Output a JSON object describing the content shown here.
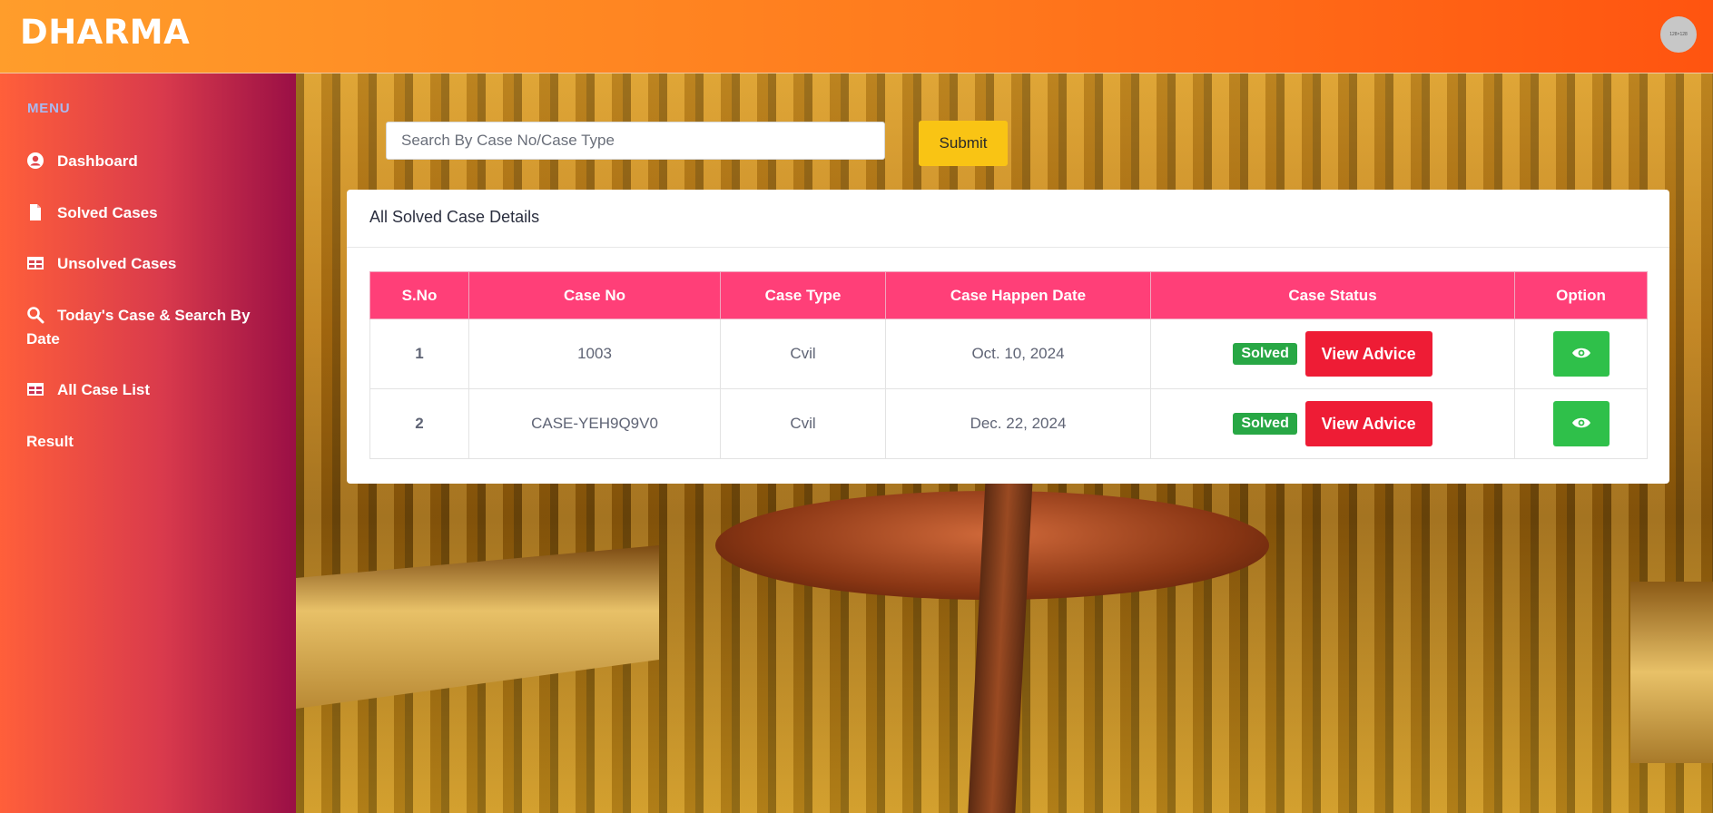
{
  "header": {
    "brand": "DHARMA",
    "avatar_text": "128×128"
  },
  "sidebar": {
    "menu_title": "MENU",
    "items": [
      {
        "label": "Dashboard",
        "icon": "user-circle-icon"
      },
      {
        "label": "Solved Cases",
        "icon": "document-icon"
      },
      {
        "label": "Unsolved Cases",
        "icon": "table-icon"
      },
      {
        "label": "Today's Case & Search By Date",
        "icon": "search-icon"
      },
      {
        "label": "All Case List",
        "icon": "table-icon"
      },
      {
        "label": "Result",
        "icon": ""
      }
    ]
  },
  "search": {
    "placeholder": "Search By Case No/Case Type",
    "value": "",
    "submit_label": "Submit"
  },
  "card": {
    "title": "All Solved Case Details",
    "columns": [
      "S.No",
      "Case No",
      "Case Type",
      "Case Happen Date",
      "Case Status",
      "Option"
    ],
    "rows": [
      {
        "sno": "1",
        "case_no": "1003",
        "case_type": "Cvil",
        "date": "Oct. 10, 2024",
        "status": "Solved",
        "action": "View Advice",
        "option_icon": "eye-icon"
      },
      {
        "sno": "2",
        "case_no": "CASE-YEH9Q9V0",
        "case_type": "Cvil",
        "date": "Dec. 22, 2024",
        "status": "Solved",
        "action": "View Advice",
        "option_icon": "eye-icon"
      }
    ]
  },
  "colors": {
    "table_header": "#ff3f78",
    "badge_solved": "#28a745",
    "advice_button": "#ee1c35",
    "view_button": "#2fc04a",
    "submit_button": "#f9c414"
  }
}
